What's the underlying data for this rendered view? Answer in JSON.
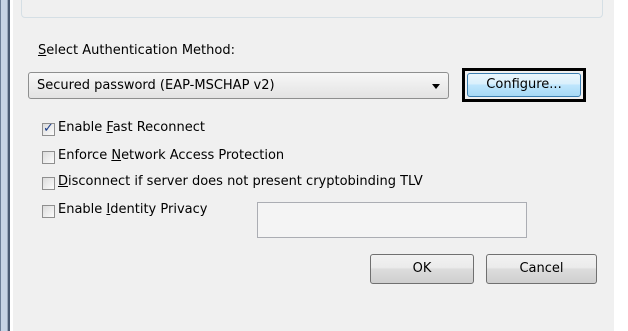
{
  "auth_method": {
    "label_pre": "",
    "label_hotkey": "S",
    "label_post": "elect Authentication Method:",
    "selected": "Secured password (EAP-MSCHAP v2)",
    "configure_label": "Configure..."
  },
  "options": [
    {
      "pre": "Enable ",
      "hotkey": "F",
      "post": "ast Reconnect",
      "checked": true
    },
    {
      "pre": "Enforce ",
      "hotkey": "N",
      "post": "etwork Access Protection",
      "checked": false
    },
    {
      "pre": "",
      "hotkey": "D",
      "post": "isconnect if server does not present cryptobinding TLV",
      "checked": false
    },
    {
      "pre": "Enable ",
      "hotkey": "I",
      "post": "dentity Privacy",
      "checked": false
    }
  ],
  "identity_value": "",
  "buttons": {
    "ok": "OK",
    "cancel": "Cancel"
  }
}
